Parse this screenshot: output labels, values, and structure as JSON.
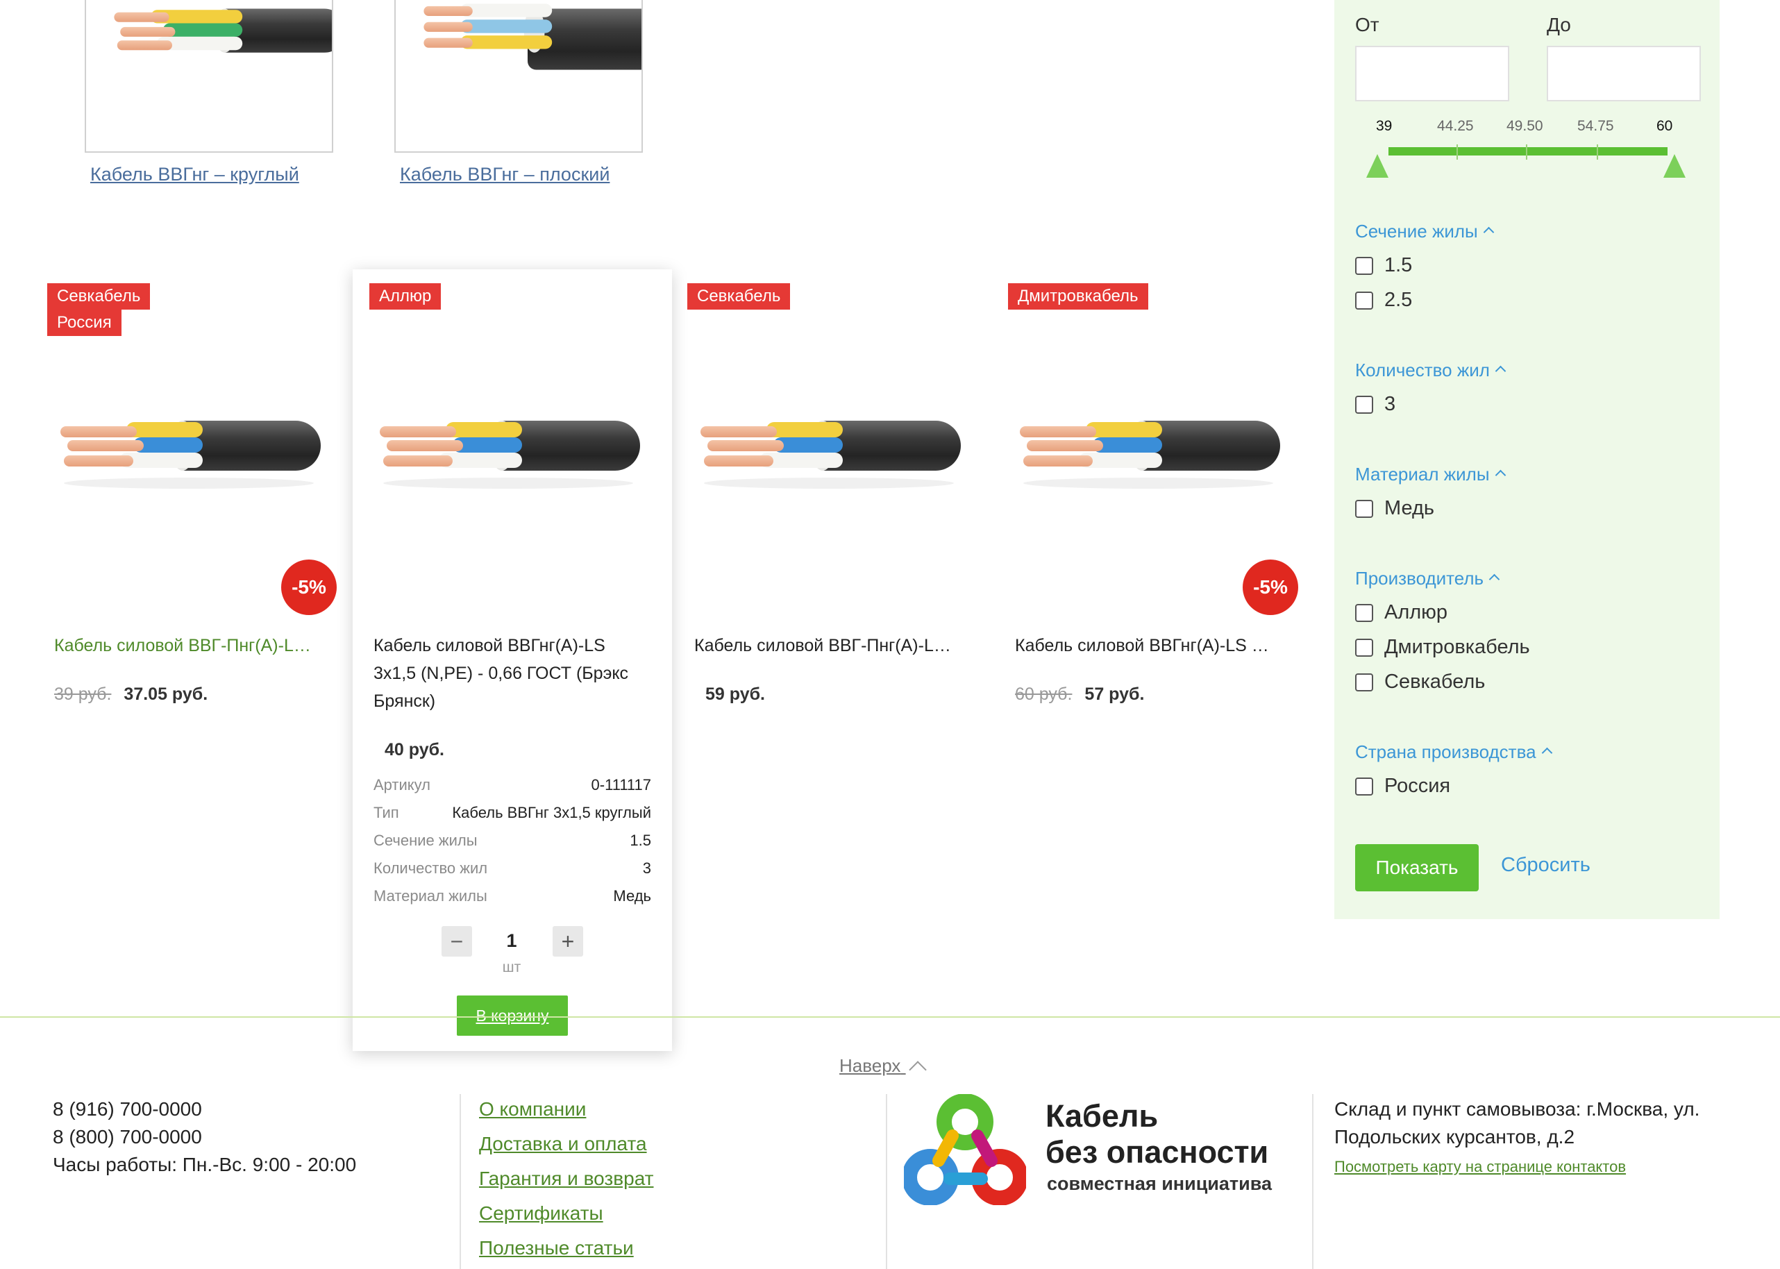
{
  "categories": [
    {
      "name": "Кабель ВВГнг – круглый"
    },
    {
      "name": "Кабель ВВГнг – плоский"
    }
  ],
  "products": [
    {
      "badges": [
        "Севкабель",
        "Россия"
      ],
      "discount": "-5%",
      "name": "Кабель силовой ВВГ-Пнг(А)-L…",
      "old_price": "39 руб.",
      "price": "37.05 руб."
    },
    {
      "badges": [
        "Аллюр"
      ],
      "name_lines": [
        "Кабель силовой ВВГнг(А)-LS",
        "3x1,5 (N,PE) - 0,66 ГОСТ (Брэкс",
        "Брянск)"
      ],
      "price": "40 руб.",
      "specs": [
        {
          "label": "Артикул",
          "value": "0-111117"
        },
        {
          "label": "Тип",
          "value": "Кабель ВВГнг 3х1,5 круглый"
        },
        {
          "label": "Сечение жилы",
          "value": "1.5"
        },
        {
          "label": "Количество жил",
          "value": "3"
        },
        {
          "label": "Материал жилы",
          "value": "Медь"
        }
      ],
      "quantity": "1",
      "unit": "шт",
      "cart_label": "В корзину"
    },
    {
      "badges": [
        "Севкабель"
      ],
      "name": "Кабель силовой ВВГ-Пнг(А)-L…",
      "price": "59 руб."
    },
    {
      "badges": [
        "Дмитровкабель"
      ],
      "discount": "-5%",
      "name": "Кабель силовой ВВГнг(А)-LS …",
      "old_price": "60 руб.",
      "price": "57 руб."
    }
  ],
  "filter": {
    "price": {
      "from_label": "От",
      "to_label": "До",
      "from_value": "",
      "to_value": "",
      "ticks": [
        "39",
        "44.25",
        "49.50",
        "54.75",
        "60"
      ],
      "min": 39,
      "max": 60
    },
    "groups": [
      {
        "title": "Сечение жилы",
        "options": [
          "1.5",
          "2.5"
        ]
      },
      {
        "title": "Количество жил",
        "options": [
          "3"
        ]
      },
      {
        "title": "Материал жилы",
        "options": [
          "Медь"
        ]
      },
      {
        "title": "Производитель",
        "options": [
          "Аллюр",
          "Дмитровкабель",
          "Севкабель"
        ]
      },
      {
        "title": "Страна производства",
        "options": [
          "Россия"
        ]
      }
    ],
    "show_label": "Показать",
    "reset_label": "Сбросить"
  },
  "footer": {
    "back_to_top": "Наверх",
    "phones": [
      "8 (916) 700-0000",
      "8 (800) 700-0000"
    ],
    "hours": "Часы работы: Пн.-Вс. 9:00 - 20:00",
    "links": [
      "О компании",
      "Доставка и оплата",
      "Гарантия и возврат",
      "Сертификаты",
      "Полезные статьи"
    ],
    "logo": {
      "line1": "Кабель",
      "line2": "без опасности",
      "line3": "совместная инициатива"
    },
    "address_lines": [
      "Склад и пункт самовывоза: г.Москва, ул.",
      "Подольских курсантов, д.2"
    ],
    "map_link": "Посмотреть карту на странице контактов"
  },
  "colors": {
    "accent_green": "#5bbf33",
    "badge_red": "#e53935",
    "filter_bg": "#eef9e8",
    "filter_link": "#3c96d6"
  }
}
